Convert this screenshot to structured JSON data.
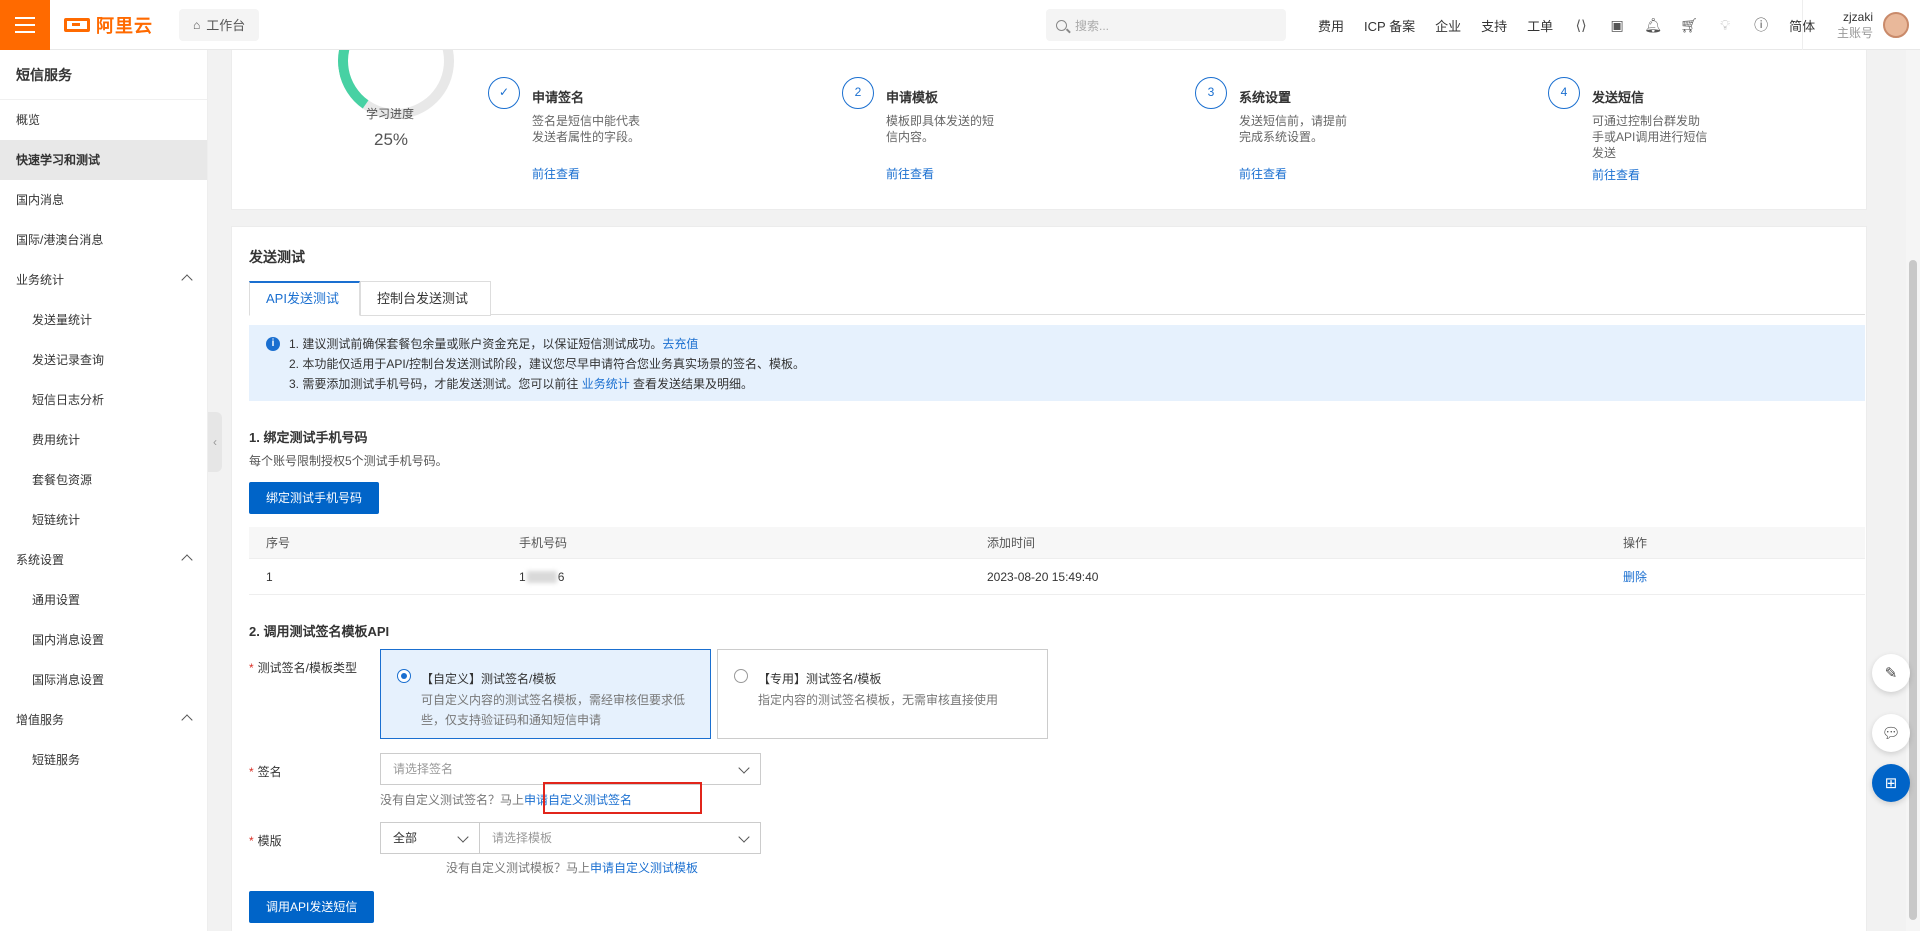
{
  "topbar": {
    "brand": "阿里云",
    "workbench": "工作台",
    "search_placeholder": "搜索...",
    "nav": [
      "费用",
      "ICP 备案",
      "企业",
      "支持",
      "工单"
    ],
    "lang": "简体",
    "user_name": "zjzaki",
    "user_role": "主账号",
    "icons": [
      "code-icon",
      "terminal-icon",
      "bell-icon",
      "cart-icon",
      "lightbulb-icon",
      "help-icon"
    ]
  },
  "sidebar": {
    "title": "短信服务",
    "items": [
      {
        "label": "概览",
        "type": "item"
      },
      {
        "label": "快速学习和测试",
        "type": "item",
        "active": true
      },
      {
        "label": "国内消息",
        "type": "item"
      },
      {
        "label": "国际/港澳台消息",
        "type": "item"
      },
      {
        "label": "业务统计",
        "type": "group"
      },
      {
        "label": "发送量统计",
        "type": "sub"
      },
      {
        "label": "发送记录查询",
        "type": "sub"
      },
      {
        "label": "短信日志分析",
        "type": "sub"
      },
      {
        "label": "费用统计",
        "type": "sub"
      },
      {
        "label": "套餐包资源",
        "type": "sub"
      },
      {
        "label": "短链统计",
        "type": "sub"
      },
      {
        "label": "系统设置",
        "type": "group"
      },
      {
        "label": "通用设置",
        "type": "sub"
      },
      {
        "label": "国内消息设置",
        "type": "sub"
      },
      {
        "label": "国际消息设置",
        "type": "sub"
      },
      {
        "label": "增值服务",
        "type": "group"
      },
      {
        "label": "短链服务",
        "type": "sub"
      }
    ]
  },
  "progress": {
    "label": "学习进度",
    "value": "25%",
    "fraction": 0.25
  },
  "steps": [
    {
      "num": "",
      "title": "申请签名",
      "desc": "签名是短信中能代表发送者属性的字段。",
      "link": "前往查看"
    },
    {
      "num": "2",
      "title": "申请模板",
      "desc": "模板即具体发送的短信内容。",
      "link": "前往查看"
    },
    {
      "num": "3",
      "title": "系统设置",
      "desc": "发送短信前，请提前完成系统设置。",
      "link": "前往查看"
    },
    {
      "num": "4",
      "title": "发送短信",
      "desc": "可通过控制台群发助手或API调用进行短信发送",
      "link": "前往查看"
    }
  ],
  "send_test": {
    "title": "发送测试",
    "tabs": [
      "API发送测试",
      "控制台发送测试"
    ],
    "notice": {
      "line1": "1. 建议测试前确保套餐包余量或账户资金充足，以保证短信测试成功。",
      "line1_link": "去充值",
      "line2": "2. 本功能仅适用于API/控制台发送测试阶段，建议您尽早申请符合您业务真实场景的签名、模板。",
      "line3_a": "3. 需要添加测试手机号码，才能发送测试。您可以前往 ",
      "line3_link": "业务统计",
      "line3_b": " 查看发送结果及明细。"
    },
    "section1": {
      "title": "1. 绑定测试手机号码",
      "desc": "每个账号限制授权5个测试手机号码。",
      "button": "绑定测试手机号码"
    },
    "table": {
      "headers": [
        "序号",
        "手机号码",
        "添加时间",
        "操作"
      ],
      "rows": [
        {
          "no": "1",
          "phone_start": "1",
          "phone_end": "6",
          "time": "2023-08-20 15:49:40",
          "action": "删除"
        }
      ]
    },
    "section2": {
      "title": "2. 调用测试签名模板API",
      "type_label": "测试签名/模板类型",
      "option1_title": "【自定义】测试签名/模板",
      "option1_desc": "可自定义内容的测试签名模板，需经审核但要求低些，仅支持验证码和通知短信申请",
      "option2_title": "【专用】测试签名/模板",
      "option2_desc": "指定内容的测试签名模板，无需审核直接使用",
      "sign_label": "签名",
      "sign_placeholder": "请选择签名",
      "sign_hint": "没有自定义测试签名？马上",
      "sign_link": "申请自定义测试签名",
      "template_label": "模版",
      "template_scope": "全部",
      "template_placeholder": "请选择模板",
      "template_hint": "没有自定义测试模板？马上",
      "template_link": "申请自定义测试模板",
      "button": "调用API发送短信"
    }
  },
  "floating": [
    "edit-icon",
    "chat-icon",
    "apps-icon"
  ],
  "colors": {
    "brand": "#ff6a00",
    "primary": "#0064c8",
    "link": "#1a6fd0",
    "progress": "#47d1a3",
    "highlight": "#e1251b"
  }
}
